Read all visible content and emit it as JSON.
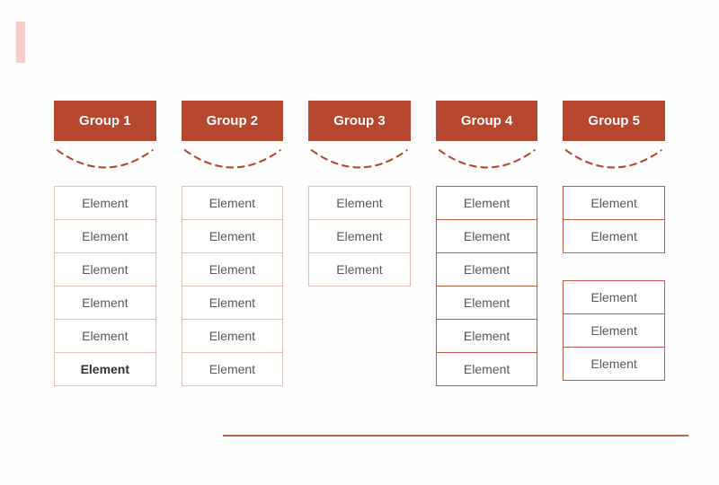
{
  "colors": {
    "accent": "#b6472f",
    "accent_light": "#f7cdc8"
  },
  "groups": [
    {
      "title": "Group 1",
      "stacks": [
        [
          {
            "label": "Element"
          },
          {
            "label": "Element"
          },
          {
            "label": "Element"
          },
          {
            "label": "Element"
          },
          {
            "label": "Element"
          },
          {
            "label": "Element",
            "bold": true
          }
        ]
      ]
    },
    {
      "title": "Group 2",
      "stacks": [
        [
          {
            "label": "Element"
          },
          {
            "label": "Element"
          },
          {
            "label": "Element"
          },
          {
            "label": "Element"
          },
          {
            "label": "Element"
          },
          {
            "label": "Element"
          }
        ]
      ]
    },
    {
      "title": "Group 3",
      "stacks": [
        [
          {
            "label": "Element"
          },
          {
            "label": "Element"
          },
          {
            "label": "Element"
          }
        ]
      ]
    },
    {
      "title": "Group 4",
      "strong": true,
      "stacks": [
        [
          {
            "label": "Element"
          },
          {
            "label": "Element"
          },
          {
            "label": "Element"
          },
          {
            "label": "Element"
          },
          {
            "label": "Element"
          },
          {
            "label": "Element"
          }
        ]
      ]
    },
    {
      "title": "Group 5",
      "strong": true,
      "stacks": [
        [
          {
            "label": "Element"
          },
          {
            "label": "Element"
          }
        ],
        [
          {
            "label": "Element"
          },
          {
            "label": "Element"
          },
          {
            "label": "Element"
          }
        ]
      ]
    }
  ]
}
